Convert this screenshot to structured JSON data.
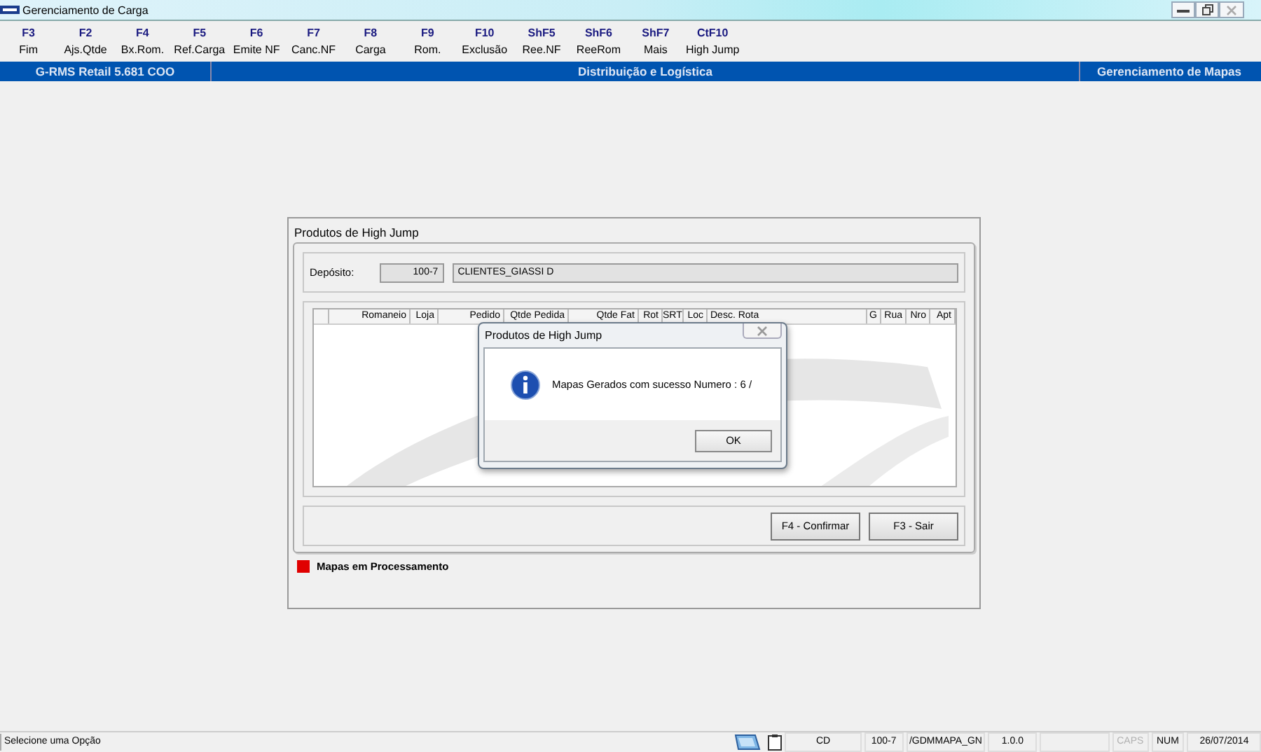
{
  "window": {
    "title": "Gerenciamento de Carga"
  },
  "toolbar": [
    {
      "key": "F3",
      "label": "Fim"
    },
    {
      "key": "F2",
      "label": "Ajs.Qtde"
    },
    {
      "key": "F4",
      "label": "Bx.Rom."
    },
    {
      "key": "F5",
      "label": "Ref.Carga"
    },
    {
      "key": "F6",
      "label": "Emite NF"
    },
    {
      "key": "F7",
      "label": "Canc.NF"
    },
    {
      "key": "F8",
      "label": "Carga"
    },
    {
      "key": "F9",
      "label": "Rom."
    },
    {
      "key": "F10",
      "label": "Exclusão"
    },
    {
      "key": "ShF5",
      "label": "Ree.NF"
    },
    {
      "key": "ShF6",
      "label": "ReeRom"
    },
    {
      "key": "ShF7",
      "label": "Mais"
    },
    {
      "key": "CtF10",
      "label": "High Jump"
    }
  ],
  "header_bar": {
    "left": "G-RMS Retail 5.681 COO",
    "center": "Distribuição e Logística",
    "right": "Gerenciamento de Mapas"
  },
  "dialog": {
    "title": "Produtos de High Jump",
    "deposit": {
      "label": "Depósito:",
      "code": "100-7",
      "name": "CLIENTES_GIASSI D"
    },
    "grid": {
      "columns": [
        "Romaneio",
        "Loja",
        "Pedido",
        "Qtde Pedida",
        "Qtde Fat",
        "Rot",
        "SRT",
        "Loc",
        "Desc. Rota",
        "G",
        "Rua",
        "Nro",
        "Apt"
      ]
    },
    "buttons": [
      "F4 - Confirmar",
      "F3 - Sair"
    ],
    "legend": [
      {
        "label": "Mapas em Processamento",
        "color": "#e00000"
      }
    ]
  },
  "message_box": {
    "title": "Produtos de High Jump",
    "message": "Mapas Gerados com sucesso Numero : 6 /",
    "button": "OK"
  },
  "status_bar": {
    "message": "Selecione uma Opção",
    "panels": [
      {
        "kind": "text",
        "text": "CD"
      },
      {
        "kind": "text",
        "text": "100-7"
      },
      {
        "kind": "text",
        "text": "/GDMMAPA_GN"
      },
      {
        "kind": "text",
        "text": "1.0.0"
      },
      {
        "kind": "blank"
      },
      {
        "kind": "indicator",
        "text": "CAPS",
        "on": false
      },
      {
        "kind": "indicator",
        "text": "NUM",
        "on": true
      },
      {
        "kind": "text",
        "text": "26/07/2014"
      }
    ]
  }
}
